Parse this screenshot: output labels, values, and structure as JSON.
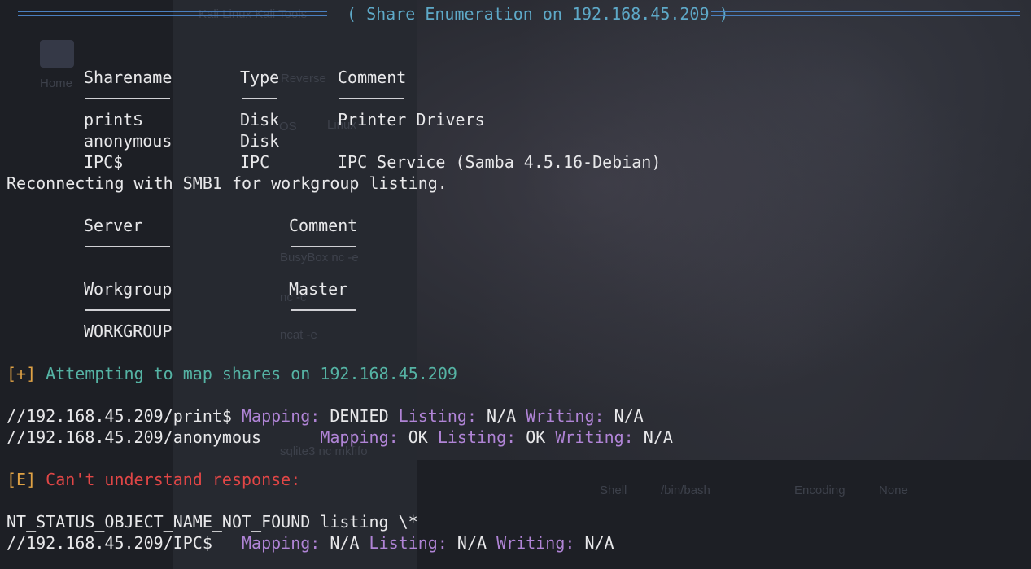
{
  "background": {
    "sidebar_label": "Home",
    "tabs": "Kali Linux   Kali Tools",
    "items": [
      "Reverse",
      "OS",
      "Linux",
      "BusyBox nc -e",
      "nc -c",
      "ncat -e",
      "sqlite3 nc mkfifo"
    ],
    "shell_label": "Shell",
    "shell_value": "/bin/bash",
    "encoding_label": "Encoding",
    "encoding_value": "None"
  },
  "banner": {
    "title": "( Share Enumeration on 192.168.45.209 )"
  },
  "shares": {
    "headers": [
      "Sharename",
      "Type",
      "Comment"
    ],
    "rows": [
      {
        "name": "print$",
        "type": "Disk",
        "comment": "Printer Drivers"
      },
      {
        "name": "anonymous",
        "type": "Disk",
        "comment": ""
      },
      {
        "name": "IPC$",
        "type": "IPC",
        "comment": "IPC Service (Samba 4.5.16-Debian)"
      }
    ]
  },
  "reconnect": "Reconnecting with SMB1 for workgroup listing.",
  "servers": {
    "headers": [
      "Server",
      "Comment"
    ]
  },
  "workgroups": {
    "headers": [
      "Workgroup",
      "Master"
    ],
    "rows": [
      {
        "name": "WORKGROUP",
        "master": ""
      }
    ]
  },
  "attempt": {
    "prefix": "[+]",
    "text": "Attempting to map shares on",
    "ip": "192.168.45.209"
  },
  "mappings": [
    {
      "path": "//192.168.45.209/print$",
      "gap": " ",
      "mapping_label": "Mapping:",
      "mapping": "DENIED",
      "listing_label": "Listing:",
      "listing": "N/A",
      "writing_label": "Writing:",
      "writing": "N/A"
    },
    {
      "path": "//192.168.45.209/anonymous",
      "gap": "      ",
      "mapping_label": "Mapping:",
      "mapping": "OK",
      "listing_label": "Listing:",
      "listing": "OK",
      "writing_label": "Writing:",
      "writing": "N/A"
    }
  ],
  "error": {
    "prefix": "[E]",
    "text": "Can't understand response:"
  },
  "nt_status": "NT_STATUS_OBJECT_NAME_NOT_FOUND listing \\*",
  "ipc_mapping": {
    "path": "//192.168.45.209/IPC$",
    "gap": "   ",
    "mapping_label": "Mapping:",
    "mapping": "N/A",
    "listing_label": "Listing:",
    "listing": "N/A",
    "writing_label": "Writing:",
    "writing": "N/A"
  },
  "colors": {
    "cyan": "#55b3a4",
    "orange": "#e0a245",
    "red": "#e04646",
    "purple": "#b084d6",
    "rule": "#4a7fc0"
  }
}
